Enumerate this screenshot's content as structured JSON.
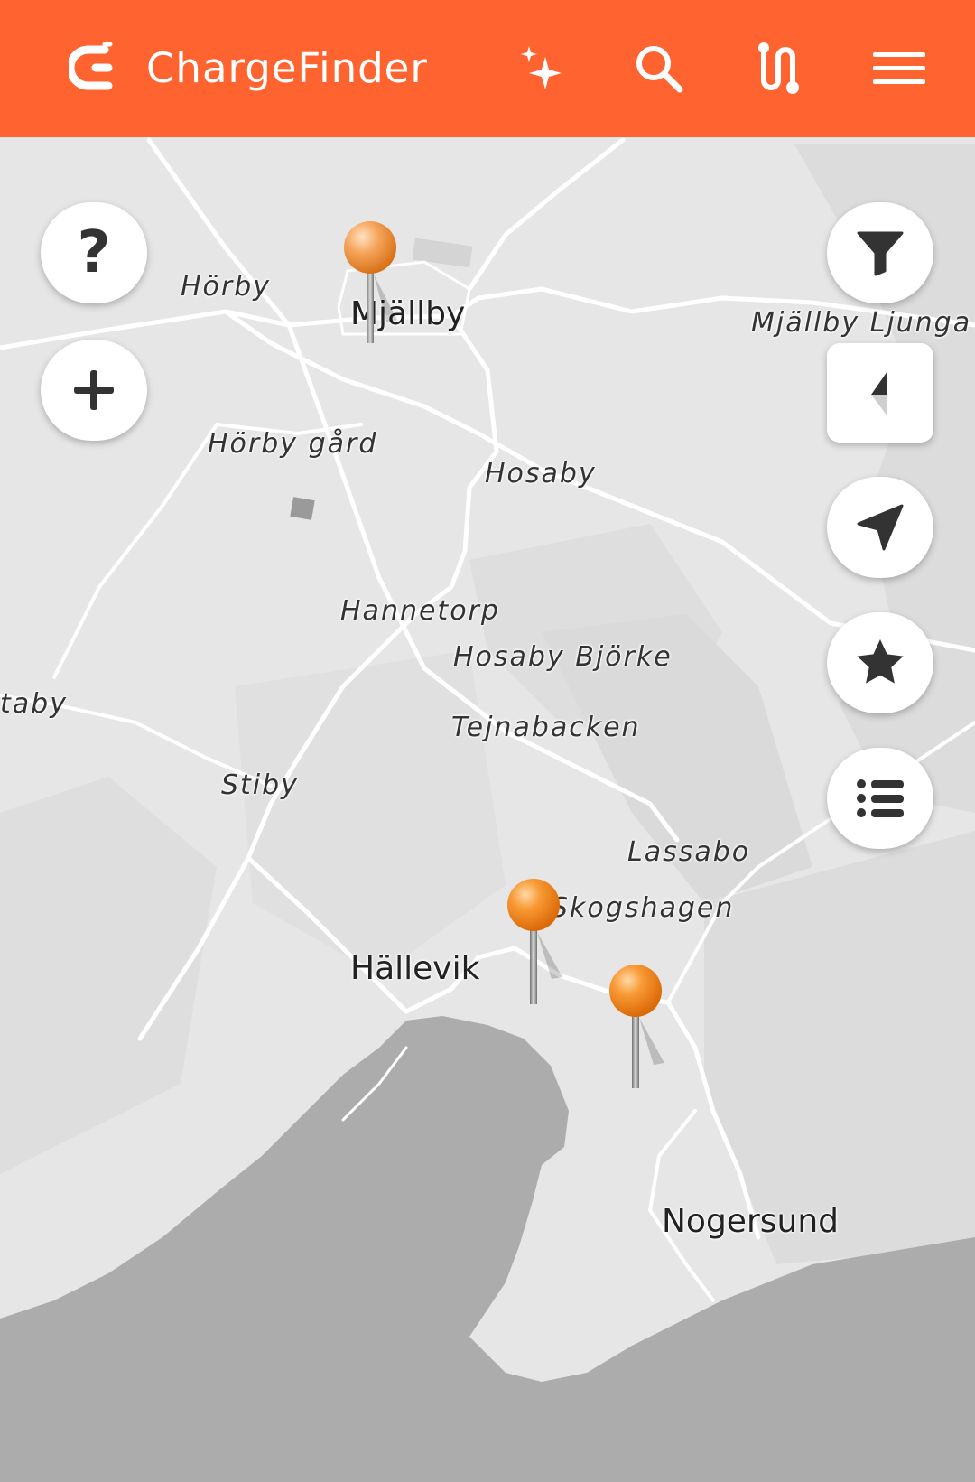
{
  "header": {
    "brand_name": "ChargeFinder",
    "bg_color": "#ff6430",
    "icons": [
      "chargefinder-logo-icon",
      "sparkles-icon",
      "search-icon",
      "route-icon",
      "menu-icon"
    ]
  },
  "map_controls": {
    "left": [
      "help-icon",
      "zoom-in-icon"
    ],
    "right": [
      "filter-icon",
      "compass-icon",
      "navigation-arrow-icon",
      "star-icon",
      "list-icon"
    ],
    "help_label": "?"
  },
  "places": {
    "horby": "Hörby",
    "mjallby": "Mjällby",
    "mjallby_ljunga": "Mjällby Ljunga",
    "horby_gard": "Hörby gård",
    "hosaby": "Hosaby",
    "hannetorp": "Hannetorp",
    "hosaby_bjorke": "Hosaby Björke",
    "taby": "taby",
    "tejnabacken": "Tejnabacken",
    "stiby": "Stiby",
    "lassabo": "Lassabo",
    "skogshagen": "Skogshagen",
    "hallevik": "Hällevik",
    "nogersund": "Nogersund"
  },
  "markers": {
    "count": 3,
    "color": "#f08a1c"
  },
  "colors": {
    "land": "#e6e6e6",
    "water": "#acacac",
    "road": "#ffffff"
  }
}
